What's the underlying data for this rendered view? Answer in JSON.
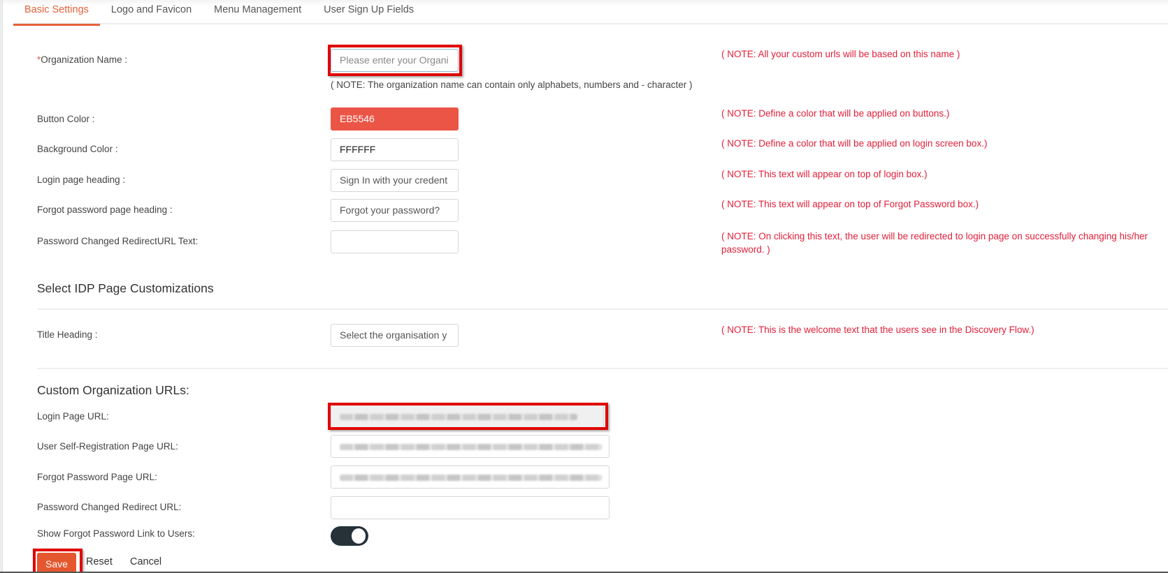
{
  "tabs": [
    {
      "label": "Basic Settings",
      "active": true
    },
    {
      "label": "Logo and Favicon",
      "active": false
    },
    {
      "label": "Menu Management",
      "active": false
    },
    {
      "label": "User Sign Up Fields",
      "active": false
    }
  ],
  "basic": {
    "org_name": {
      "required_mark": "*",
      "label": "Organization Name :",
      "placeholder": "Please enter your Organi",
      "value": "",
      "subnote": "( NOTE: The organization name can contain only alphabets, numbers and - character )",
      "note": "( NOTE: All your custom urls will be based on this name )"
    },
    "button_color": {
      "label": "Button Color :",
      "value": "EB5546",
      "swatch": "#EB5546",
      "note": "( NOTE: Define a color that will be applied on buttons.)"
    },
    "background_color": {
      "label": "Background Color :",
      "value": "FFFFFF",
      "swatch": "#FFFFFF",
      "note": "( NOTE: Define a color that will be applied on login screen box.)"
    },
    "login_heading": {
      "label": "Login page heading :",
      "value": "Sign In with your credent",
      "note": "( NOTE: This text will appear on top of login box.)"
    },
    "forgot_heading": {
      "label": "Forgot password page heading :",
      "value": "Forgot your password?",
      "note": "( NOTE: This text will appear on top of Forgot Password box.)"
    },
    "redirect_text": {
      "label": "Password Changed RedirectURL Text:",
      "value": "",
      "note": "( NOTE: On clicking this text, the user will be redirected to login page on successfully changing his/her password. )"
    }
  },
  "idp": {
    "title": "Select IDP Page Customizations",
    "title_heading": {
      "label": "Title Heading :",
      "value": "Select the organisation y",
      "note": "( NOTE: This is the welcome text that the users see in the Discovery Flow.)"
    }
  },
  "urls": {
    "title": "Custom Organization URLs:",
    "login_url": {
      "label": "Login Page URL:"
    },
    "self_reg_url": {
      "label": "User Self-Registration Page URL:"
    },
    "forgot_url": {
      "label": "Forgot Password Page URL:"
    },
    "redirect_url": {
      "label": "Password Changed Redirect URL:",
      "value": ""
    },
    "show_forgot": {
      "label": "Show Forgot Password Link to Users:",
      "enabled": true
    }
  },
  "actions": {
    "save": "Save",
    "reset": "Reset",
    "cancel": "Cancel"
  },
  "colors": {
    "accent": "#E5623A",
    "note": "#E0203A",
    "highlight": "#E00000",
    "toggle_on": "#263238"
  }
}
